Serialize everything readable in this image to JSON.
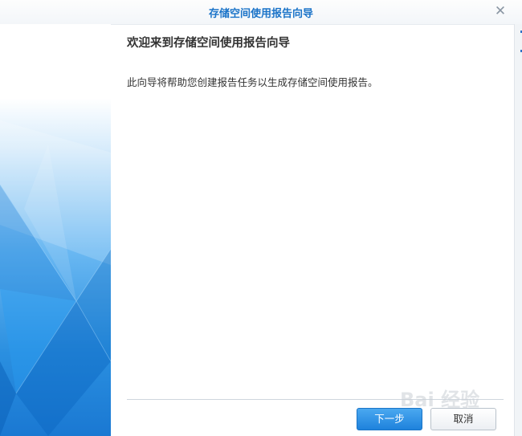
{
  "window": {
    "title": "存储空间使用报告向导",
    "close_glyph": "✕"
  },
  "wizard": {
    "heading": "欢迎来到存储空间使用报告向导",
    "description": "此向导将帮助您创建报告任务以生成存储空间使用报告。"
  },
  "buttons": {
    "next_label": "下一步",
    "cancel_label": "取消"
  },
  "watermark": {
    "text": "Bai 经验"
  },
  "colors": {
    "title_text": "#1a73c8",
    "primary_button": "#1e82dc",
    "banner_blue": "#2a8fe0"
  }
}
